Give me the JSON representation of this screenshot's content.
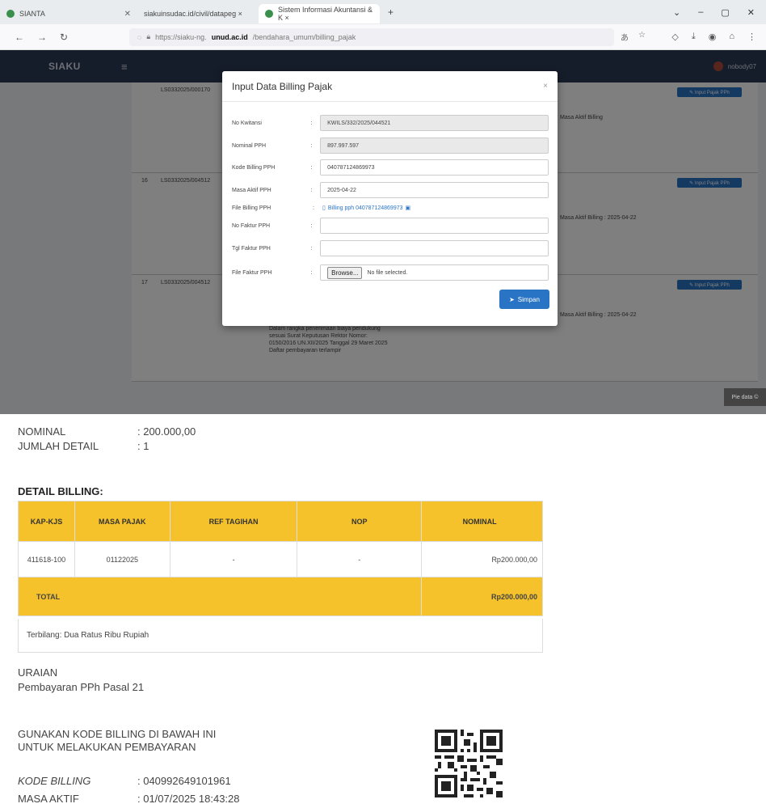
{
  "browser": {
    "tabs": [
      {
        "label": "SIANTA"
      },
      {
        "label": "siakuinsudac.id/civil/datapeg ×"
      },
      {
        "label": "Sistem Informasi Akuntansi & K ×"
      }
    ],
    "new_tab": "+",
    "url_prefix": "https://siaku-ng.",
    "url_domain": "unud.ac.id",
    "url_path": "/bendahara_umum/billing_pajak"
  },
  "app": {
    "brand": "SIAKU",
    "menu_icon": "≡",
    "user": "nobody07"
  },
  "background_table": {
    "rows": [
      {
        "no": "",
        "code": "LS0332025/000170",
        "button": "✎ Input Pajak PPh",
        "info": "Masa Aktif Billing"
      },
      {
        "no": "16",
        "code": "LS0332025/004512",
        "button": "✎ Input Pajak PPh",
        "info": "Masa Aktif Billing : 2025-04-22"
      },
      {
        "no": "17",
        "code": "LS0332025/004512",
        "button": "✎ Input Pajak PPh",
        "info": "Masa Aktif Billing : 2025-04-22"
      }
    ],
    "note": "Dalam rangka penerimaan biaya pendukung sesuai Surat Keputusan Rektor Nomor: 0150/2016 UN.XII/2025 Tanggal 29 Maret 2025 Daftar pembayaran terlampir",
    "toast": "Pie data ©"
  },
  "modal": {
    "title": "Input Data Billing Pajak",
    "close": "×",
    "fields": [
      {
        "label": "No Kwitansi",
        "value": "KWILS/332/2025/044521",
        "readonly": true
      },
      {
        "label": "Nominal PPH",
        "value": "897.997.597",
        "readonly": true
      },
      {
        "label": "Kode Billing PPH",
        "value": "040787124869973",
        "readonly": false
      },
      {
        "label": "Masa Aktif PPH",
        "value": "2025-04-22",
        "readonly": false
      },
      {
        "label": "File Billing PPH",
        "value": "Billing pph 040787124869973",
        "readonly": false
      },
      {
        "label": "No Faktur PPH",
        "value": "",
        "readonly": false
      },
      {
        "label": "Tgl Faktur PPH",
        "value": "",
        "readonly": false
      },
      {
        "label": "File Faktur PPH",
        "value": "No file selected.",
        "readonly": false
      }
    ],
    "colon": ":",
    "browse": "Browse...",
    "save": "Simpan"
  },
  "document": {
    "nominal_label": "NOMINAL",
    "nominal_value": ": 200.000,00",
    "jumlah_label": "JUMLAH DETAIL",
    "jumlah_value": ": 1",
    "detail_title": "DETAIL BILLING:",
    "table": {
      "headers": [
        "KAP-KJS",
        "MASA PAJAK",
        "REF TAGIHAN",
        "NOP",
        "NOMINAL"
      ],
      "rows": [
        [
          "411618-100",
          "01122025",
          "-",
          "-",
          "Rp200.000,00"
        ]
      ],
      "total_label": "TOTAL",
      "total_value": "Rp200.000,00"
    },
    "terbilang": "Terbilang: Dua Ratus Ribu Rupiah",
    "uraian_label": "URAIAN",
    "uraian_value": "Pembayaran PPh Pasal 21",
    "instruction_line1": "GUNAKAN KODE BILLING DI BAWAH INI",
    "instruction_line2": "UNTUK MELAKUKAN PEMBAYARAN",
    "kode_label": "KODE BILLING",
    "kode_value": ": 040992649101961",
    "masa_label": "MASA AKTIF",
    "masa_value": ": 01/07/2025 18:43:28"
  }
}
